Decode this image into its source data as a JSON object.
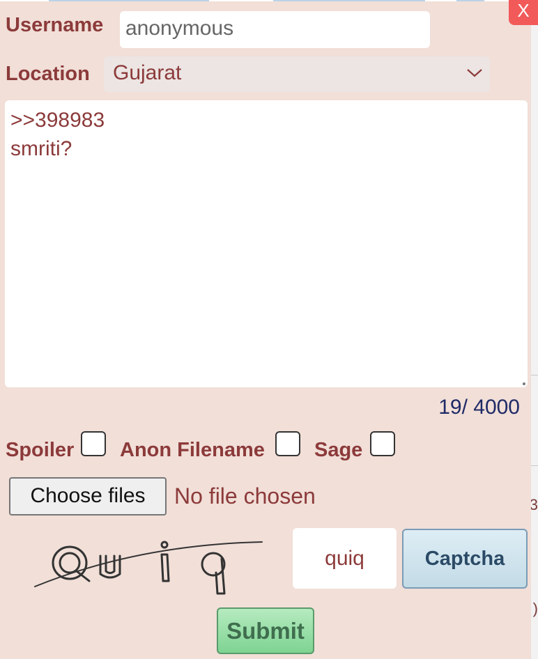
{
  "form": {
    "close_label": "X",
    "username": {
      "label": "Username",
      "value": "anonymous"
    },
    "location": {
      "label": "Location",
      "selected": "Gujarat"
    },
    "message": {
      "lines": [
        ">>398983",
        "smriti?"
      ],
      "char_count": "19/ 4000"
    },
    "options": {
      "spoiler_label": "Spoiler",
      "anon_filename_label": "Anon Filename",
      "sage_label": "Sage"
    },
    "file": {
      "button_label": "Choose files",
      "status": "No file chosen"
    },
    "captcha": {
      "image_text": "Quiq",
      "input_value": "quiq",
      "button_label": "Captcha"
    },
    "submit_label": "Submit"
  },
  "colors": {
    "panel_bg": "#f1dfd8",
    "label_text": "#8c3a3a",
    "counter_text": "#1f2a66",
    "close_bg": "#f25a5a",
    "submit_bg": "#7ed392",
    "captcha_btn_bg": "#c3dbe6"
  },
  "icons": {
    "select_arrow": "chevron-down-icon"
  }
}
